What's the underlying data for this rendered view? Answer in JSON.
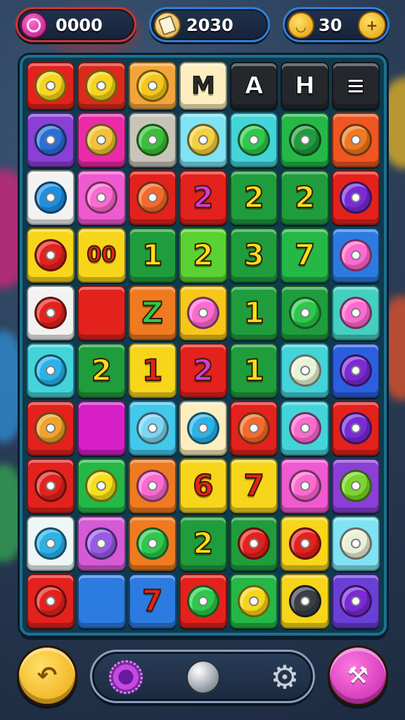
{
  "hud": {
    "gems": {
      "value": "0000",
      "icon": "pink-gem-icon"
    },
    "scrolls": {
      "value": "2030",
      "icon": "scroll-icon"
    },
    "coins": {
      "value": "30",
      "icon": "smiley-coin-icon",
      "add_icon": "coin-plus-icon"
    }
  },
  "board": {
    "header_row": [
      {
        "label": "",
        "color": "#e3221d",
        "icon": "pattern-badge-icon"
      },
      {
        "label": "",
        "color": "#d92a1c",
        "icon": "ornament-icon"
      },
      {
        "label": "",
        "color": "#f3a43a",
        "icon": "leaf-icon"
      },
      {
        "label": "M",
        "color": "#fdeebf"
      },
      {
        "label": "A",
        "color": "#24272c"
      },
      {
        "label": "H",
        "color": "#24272c"
      },
      {
        "label": "≡",
        "color": "#24272c"
      }
    ],
    "rows": [
      [
        {
          "color": "#8a3fd6",
          "icon": "blue-ball-icon"
        },
        {
          "color": "#ec2aa8",
          "icon": "cookie-icon"
        },
        {
          "color": "#c9c4b8",
          "icon": "green-apple-icon"
        },
        {
          "color": "#7fe3f3",
          "icon": "bone-icon"
        },
        {
          "color": "#42d4d9",
          "icon": "green-button-icon"
        },
        {
          "color": "#25b847",
          "icon": "check-leaf-icon"
        },
        {
          "color": "#ef5622",
          "icon": "orange-fruit-icon"
        }
      ],
      [
        {
          "color": "#f2f2f2",
          "icon": "blue-ring-icon"
        },
        {
          "color": "#f05ad0",
          "icon": "pink-squiggle-icon"
        },
        {
          "color": "#e3221d",
          "icon": "slash-icon"
        },
        {
          "color": "#e3221d",
          "label": "2"
        },
        {
          "color": "#1f9c3c",
          "label": "2"
        },
        {
          "color": "#1f9c3c",
          "label": "2"
        },
        {
          "color": "#e3221d",
          "icon": "purple-button-icon"
        }
      ],
      [
        {
          "color": "#f7d51a",
          "icon": "red-ring-icon"
        },
        {
          "color": "#f7d51a",
          "label": "00"
        },
        {
          "color": "#1f9c3c",
          "label": "1"
        },
        {
          "color": "#5ad234",
          "label": "2"
        },
        {
          "color": "#1f9c3c",
          "label": "3"
        },
        {
          "color": "#25b847",
          "label": "7"
        },
        {
          "color": "#2b7be0",
          "icon": "pink-cross-icon"
        }
      ],
      [
        {
          "color": "#f2f2f2",
          "icon": "red-button-icon"
        },
        {
          "color": "#e3221d",
          "icon": ""
        },
        {
          "color": "#f07a1f",
          "label": "Z"
        },
        {
          "color": "#f7c61a",
          "icon": "pink-squiggle-icon"
        },
        {
          "color": "#1f9c3c",
          "label": "1"
        },
        {
          "color": "#1f9c3c",
          "icon": "green-button-icon"
        },
        {
          "color": "#43d0c0",
          "icon": "pink-button-icon"
        }
      ],
      [
        {
          "color": "#42d4d9",
          "icon": "blue-bomb-icon"
        },
        {
          "color": "#1f9c3c",
          "label": "2"
        },
        {
          "color": "#f7d51a",
          "label": "1"
        },
        {
          "color": "#e3221d",
          "label": "2"
        },
        {
          "color": "#1f9c3c",
          "label": "1"
        },
        {
          "color": "#42d4d9",
          "icon": "white-hook-icon"
        },
        {
          "color": "#2b5fe0",
          "icon": "purple-swirl-icon"
        }
      ],
      [
        {
          "color": "#e3221d",
          "icon": "face-ball-icon"
        },
        {
          "color": "#d61fc7",
          "icon": ""
        },
        {
          "color": "#42c8ea",
          "icon": "blue-curl-icon"
        },
        {
          "color": "#fdeebf",
          "icon": "beach-ball-icon"
        },
        {
          "color": "#e3221d",
          "icon": "slash-icon"
        },
        {
          "color": "#42d4d9",
          "icon": "pink-creature-icon"
        },
        {
          "color": "#e3221d",
          "icon": "purple-button-icon"
        }
      ],
      [
        {
          "color": "#e3221d",
          "icon": "red-apple-icon"
        },
        {
          "color": "#25b847",
          "icon": "yellow-chomper-icon"
        },
        {
          "color": "#f07a1f",
          "icon": "pink-pin-icon"
        },
        {
          "color": "#f7d51a",
          "label": "6"
        },
        {
          "color": "#f7d51a",
          "label": "7"
        },
        {
          "color": "#f05ad0",
          "icon": "pink-button-icon"
        },
        {
          "color": "#8a3fd6",
          "icon": "green-dotted-icon"
        }
      ],
      [
        {
          "color": "#ecf7f6",
          "icon": "beach-ball-icon"
        },
        {
          "color": "#d65ad6",
          "icon": "purple-stick-icon"
        },
        {
          "color": "#f07a1f",
          "icon": "green-check-icon"
        },
        {
          "color": "#1f9c3c",
          "label": "2"
        },
        {
          "color": "#1f9c3c",
          "icon": "red-slash-icon"
        },
        {
          "color": "#f7d51a",
          "icon": "tomato-icon"
        },
        {
          "color": "#7fe3f3",
          "icon": "egg-icon"
        }
      ],
      [
        {
          "color": "#e3221d",
          "icon": "red-button-icon"
        },
        {
          "color": "#2b7be0",
          "icon": ""
        },
        {
          "color": "#2b7be0",
          "label": "7"
        },
        {
          "color": "#e3221d",
          "icon": "green-cross-icon"
        },
        {
          "color": "#25b847",
          "icon": "smiley-icon"
        },
        {
          "color": "#f7d51a",
          "icon": "stone-icon"
        },
        {
          "color": "#6a3fd6",
          "icon": "purple-button-icon"
        }
      ]
    ]
  },
  "controls": {
    "undo": {
      "icon": "undo-arrow-icon",
      "glyph": "↶",
      "color": "#f2b420"
    },
    "tray": {
      "left_icon": "purple-badge-icon",
      "center_icon": "silver-ball-icon",
      "right_icon": "gear-icon",
      "gear_glyph": "⚙"
    },
    "magic": {
      "icon": "magic-wand-icon",
      "glyph": "⚒",
      "color": "#d62ab8"
    }
  }
}
